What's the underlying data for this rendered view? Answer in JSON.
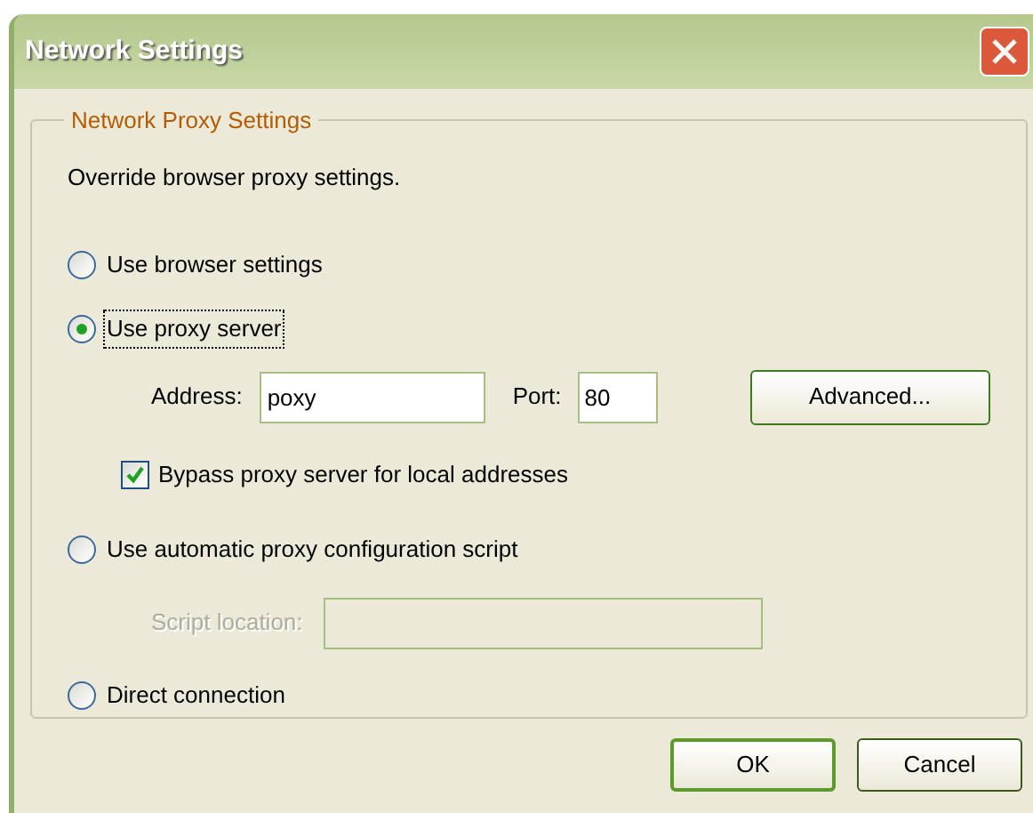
{
  "window": {
    "title": "Network Settings"
  },
  "group": {
    "legend": "Network Proxy Settings",
    "description": "Override browser proxy settings."
  },
  "options": [
    {
      "kind": "radio",
      "label": "Use browser settings",
      "selected": false,
      "focused": false
    },
    {
      "kind": "radio",
      "label": "Use proxy server",
      "selected": true,
      "focused": true
    },
    {
      "kind": "proxy_fields",
      "address_label": "Address:",
      "address_value": "poxy",
      "port_label": "Port:",
      "port_value": "80",
      "button": "Advanced..."
    },
    {
      "kind": "checkbox",
      "label": "Bypass proxy server for local addresses",
      "checked": true
    },
    {
      "kind": "radio",
      "label": "Use automatic proxy configuration script",
      "selected": false,
      "focused": false
    },
    {
      "kind": "script_field",
      "label": "Script location:",
      "disabled": true
    },
    {
      "kind": "radio",
      "label": "Direct connection",
      "selected": false,
      "focused": false
    }
  ],
  "buttons": [
    {
      "label": "OK",
      "default": true
    },
    {
      "label": "Cancel",
      "default": false
    }
  ]
}
